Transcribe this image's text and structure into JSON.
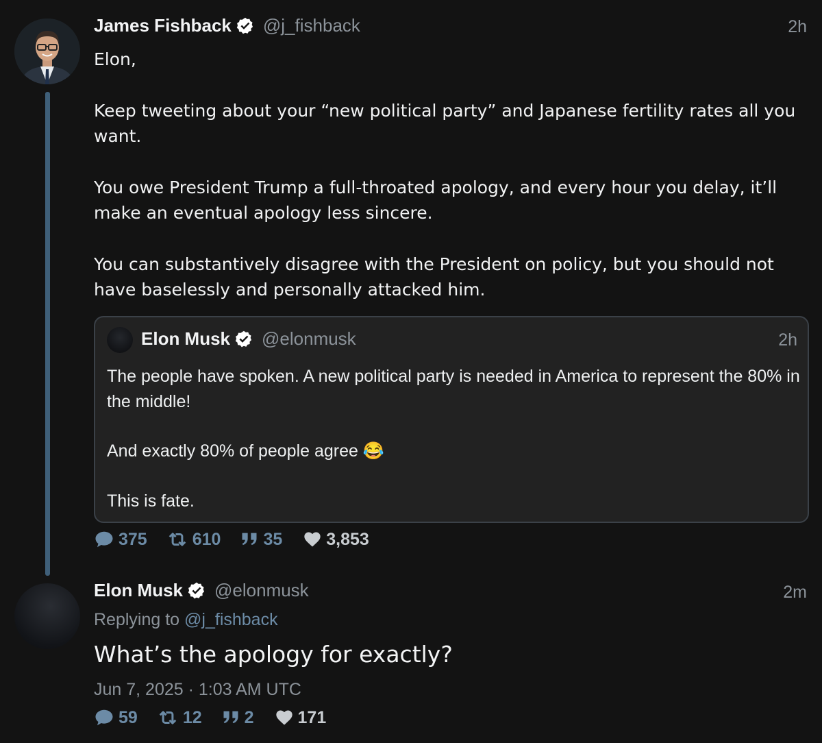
{
  "tweet1": {
    "name": "James Fishback",
    "handle": "@j_fishback",
    "time": "2h",
    "paragraphs": [
      "Elon,",
      "Keep tweeting about your “new political party” and Japanese fertility rates all you want.",
      "You owe President Trump a full-throated apology, and every hour you delay, it’ll make an eventual apology less sincere.",
      "You can substantively disagree with the President on policy, but you should not have baselessly and personally attacked him."
    ],
    "quote": {
      "name": "Elon Musk",
      "handle": "@elonmusk",
      "time": "2h",
      "paragraphs": [
        "The people have spoken. A new political party is needed in America to represent the 80% in the middle!",
        "And exactly 80% of people agree 😂",
        "This is fate."
      ]
    },
    "stats": {
      "replies": "375",
      "retweets": "610",
      "quotes": "35",
      "likes": "3,853"
    }
  },
  "tweet2": {
    "name": "Elon Musk",
    "handle": "@elonmusk",
    "time": "2m",
    "replying_label": "Replying to",
    "replying_handle": "@j_fishback",
    "text": "What’s the apology for exactly?",
    "date": "Jun 7, 2025 · 1:03 AM UTC",
    "stats": {
      "replies": "59",
      "retweets": "12",
      "quotes": "2",
      "likes": "171"
    }
  },
  "colors": {
    "background": "#131313",
    "accent": "#6c8ba6",
    "thread_line": "#3f5f79",
    "verified": "#ffffff"
  }
}
